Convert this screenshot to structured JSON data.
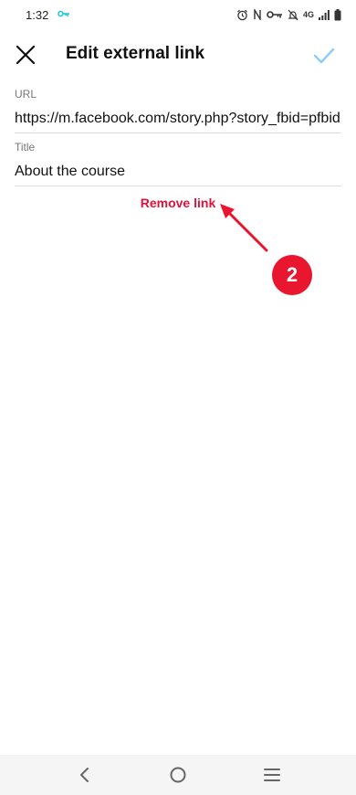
{
  "status_bar": {
    "time": "1:32",
    "network": "4G"
  },
  "header": {
    "title": "Edit external link",
    "close_icon": "close-icon",
    "confirm_icon": "checkmark-icon"
  },
  "form": {
    "url_label": "URL",
    "url_value": "https://m.facebook.com/story.php?story_fbid=pfbid",
    "title_label": "Title",
    "title_value": "About the course"
  },
  "actions": {
    "remove_link": "Remove link"
  },
  "annotation": {
    "step_number": "2"
  },
  "colors": {
    "accent_red": "#e3123b",
    "confirm_blue": "#90cdf4",
    "badge_red": "#e8162f"
  }
}
